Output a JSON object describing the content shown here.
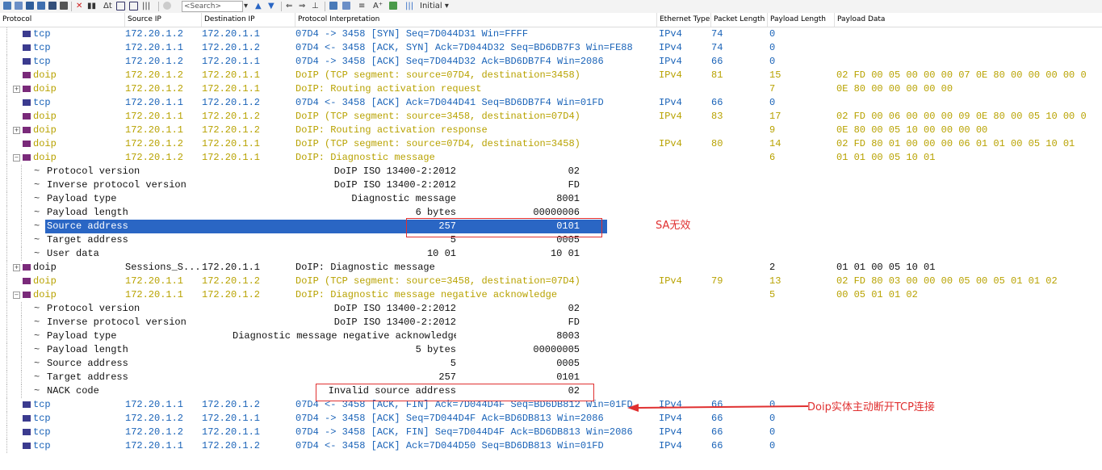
{
  "toolbar": {
    "search_placeholder": "<Search>",
    "profile_label": "Initial"
  },
  "columns": {
    "protocol": "Protocol",
    "source_ip": "Source IP",
    "destination_ip": "Destination IP",
    "interpretation": "Protocol Interpretation",
    "ethernet_type": "Ethernet Type",
    "packet_length": "Packet Length",
    "payload_length": "Payload Length",
    "payload_data": "Payload Data"
  },
  "rows": [
    {
      "proto": "tcp",
      "src": "172.20.1.2",
      "dst": "172.20.1.1",
      "interp": "07D4 -> 3458 [SYN] Seq=7D044D31 Win=FFFF",
      "eth": "IPv4",
      "pkt": "74",
      "pl": "0",
      "data": ""
    },
    {
      "proto": "tcp",
      "src": "172.20.1.1",
      "dst": "172.20.1.2",
      "interp": "07D4 <- 3458 [ACK, SYN] Ack=7D044D32 Seq=BD6DB7F3 Win=FE88",
      "eth": "IPv4",
      "pkt": "74",
      "pl": "0",
      "data": ""
    },
    {
      "proto": "tcp",
      "src": "172.20.1.2",
      "dst": "172.20.1.1",
      "interp": "07D4 -> 3458 [ACK] Seq=7D044D32 Ack=BD6DB7F4 Win=2086",
      "eth": "IPv4",
      "pkt": "66",
      "pl": "0",
      "data": ""
    },
    {
      "proto": "doip",
      "src": "172.20.1.2",
      "dst": "172.20.1.1",
      "interp": "DoIP (TCP segment: source=07D4, destination=3458)",
      "eth": "IPv4",
      "pkt": "81",
      "pl": "15",
      "data": "02 FD 00 05 00 00 00 07 0E 80 00 00 00 00 0"
    },
    {
      "proto": "doip",
      "src": "172.20.1.2",
      "dst": "172.20.1.1",
      "interp": "DoIP: Routing activation request",
      "eth": "",
      "pkt": "",
      "pl": "7",
      "data": "0E 80 00 00 00 00 00"
    },
    {
      "proto": "tcp",
      "src": "172.20.1.1",
      "dst": "172.20.1.2",
      "interp": "07D4 <- 3458 [ACK] Ack=7D044D41 Seq=BD6DB7F4 Win=01FD",
      "eth": "IPv4",
      "pkt": "66",
      "pl": "0",
      "data": ""
    },
    {
      "proto": "doip",
      "src": "172.20.1.1",
      "dst": "172.20.1.2",
      "interp": "DoIP (TCP segment: source=3458, destination=07D4)",
      "eth": "IPv4",
      "pkt": "83",
      "pl": "17",
      "data": "02 FD 00 06 00 00 00 09 0E 80 00 05 10 00 0"
    },
    {
      "proto": "doip",
      "src": "172.20.1.1",
      "dst": "172.20.1.2",
      "interp": "DoIP: Routing activation response",
      "eth": "",
      "pkt": "",
      "pl": "9",
      "data": "0E 80 00 05 10 00 00 00 00"
    },
    {
      "proto": "doip",
      "src": "172.20.1.2",
      "dst": "172.20.1.1",
      "interp": "DoIP (TCP segment: source=07D4, destination=3458)",
      "eth": "IPv4",
      "pkt": "80",
      "pl": "14",
      "data": "02 FD 80 01 00 00 00 06 01 01 00 05 10 01"
    },
    {
      "proto": "doip",
      "src": "172.20.1.2",
      "dst": "172.20.1.1",
      "interp": "DoIP: Diagnostic message",
      "eth": "",
      "pkt": "",
      "pl": "6",
      "data": "01 01 00 05 10 01"
    },
    {
      "field": "Protocol version",
      "val": "DoIP ISO 13400-2:2012",
      "raw": "02"
    },
    {
      "field": "Inverse protocol version",
      "val": "DoIP ISO 13400-2:2012",
      "raw": "FD"
    },
    {
      "field": "Payload type",
      "val": "Diagnostic message",
      "raw": "8001"
    },
    {
      "field": "Payload length",
      "val": "6 bytes",
      "raw": "00000006"
    },
    {
      "field": "Source address",
      "val": "257",
      "raw": "0101"
    },
    {
      "field": "Target address",
      "val": "5",
      "raw": "0005"
    },
    {
      "field": "User data",
      "val": "10 01",
      "raw": "10 01"
    },
    {
      "proto": "doip",
      "src": "Sessions_S...",
      "dst": "172.20.1.1",
      "interp": "DoIP: Diagnostic message",
      "eth": "",
      "pkt": "",
      "pl": "2",
      "data": "01 01 00 05 10 01"
    },
    {
      "proto": "doip",
      "src": "172.20.1.1",
      "dst": "172.20.1.2",
      "interp": "DoIP (TCP segment: source=3458, destination=07D4)",
      "eth": "IPv4",
      "pkt": "79",
      "pl": "13",
      "data": "02 FD 80 03 00 00 00 05 00 05 01 01 02"
    },
    {
      "proto": "doip",
      "src": "172.20.1.1",
      "dst": "172.20.1.2",
      "interp": "DoIP: Diagnostic message negative acknowledge",
      "eth": "",
      "pkt": "",
      "pl": "5",
      "data": "00 05 01 01 02"
    },
    {
      "field": "Protocol version",
      "val": "DoIP ISO 13400-2:2012",
      "raw": "02"
    },
    {
      "field": "Inverse protocol version",
      "val": "DoIP ISO 13400-2:2012",
      "raw": "FD"
    },
    {
      "field": "Payload type",
      "val": "Diagnostic message negative acknowledge",
      "raw": "8003"
    },
    {
      "field": "Payload length",
      "val": "5 bytes",
      "raw": "00000005"
    },
    {
      "field": "Source address",
      "val": "5",
      "raw": "0005"
    },
    {
      "field": "Target address",
      "val": "257",
      "raw": "0101"
    },
    {
      "field": "NACK code",
      "val": "Invalid source address",
      "raw": "02"
    },
    {
      "proto": "tcp",
      "src": "172.20.1.1",
      "dst": "172.20.1.2",
      "interp": "07D4 <- 3458 [ACK, FIN] Ack=7D044D4F Seq=BD6DB812 Win=01FD",
      "eth": "IPv4",
      "pkt": "66",
      "pl": "0",
      "data": ""
    },
    {
      "proto": "tcp",
      "src": "172.20.1.2",
      "dst": "172.20.1.1",
      "interp": "07D4 -> 3458 [ACK] Seq=7D044D4F Ack=BD6DB813 Win=2086",
      "eth": "IPv4",
      "pkt": "66",
      "pl": "0",
      "data": ""
    },
    {
      "proto": "tcp",
      "src": "172.20.1.2",
      "dst": "172.20.1.1",
      "interp": "07D4 -> 3458 [ACK, FIN] Seq=7D044D4F Ack=BD6DB813 Win=2086",
      "eth": "IPv4",
      "pkt": "66",
      "pl": "0",
      "data": ""
    },
    {
      "proto": "tcp",
      "src": "172.20.1.1",
      "dst": "172.20.1.2",
      "interp": "07D4 <- 3458 [ACK] Ack=7D044D50 Seq=BD6DB813 Win=01FD",
      "eth": "IPv4",
      "pkt": "66",
      "pl": "0",
      "data": ""
    }
  ],
  "selected_row": 14,
  "annotations": {
    "sa_invalid": "SA无效",
    "doip_disconnect": "Doip实体主动断开TCP连接"
  },
  "colors": {
    "tcp": "#1a63b8",
    "doip": "#b8a200",
    "selection": "#2a66c4",
    "annotation": "#e03030"
  }
}
